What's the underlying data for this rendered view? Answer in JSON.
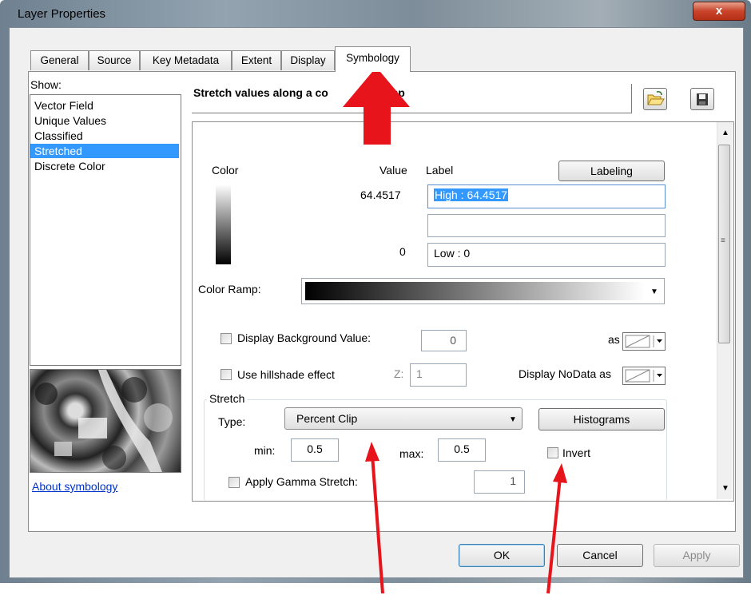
{
  "window": {
    "title": "Layer Properties",
    "close_glyph": "x"
  },
  "tabs": [
    {
      "label": "General"
    },
    {
      "label": "Source"
    },
    {
      "label": "Key Metadata"
    },
    {
      "label": "Extent"
    },
    {
      "label": "Display"
    },
    {
      "label": "Symbology",
      "active": true
    }
  ],
  "show": {
    "label": "Show:",
    "items": [
      "Vector Field",
      "Unique Values",
      "Classified",
      "Stretched",
      "Discrete Color"
    ],
    "selected": "Stretched",
    "about_link": "About symbology"
  },
  "header": {
    "title": "Stretch values along a co",
    "title_tail": "mp"
  },
  "ramp_table": {
    "color_header": "Color",
    "value_header": "Value",
    "label_header": "Label",
    "labeling_button": "Labeling",
    "high_value": "64.4517",
    "high_label": "High : 64.4517",
    "mid_label": "",
    "low_value": "0",
    "low_label": "Low : 0"
  },
  "color_ramp": {
    "label": "Color Ramp:"
  },
  "background": {
    "label": "Display Background Value:",
    "value": "0",
    "as_label": "as",
    "checked": false
  },
  "hillshade": {
    "label": "Use hillshade effect",
    "z_label": "Z:",
    "z_value": "1",
    "nodata_label": "Display NoData as",
    "checked": false
  },
  "stretch": {
    "group_label": "Stretch",
    "type_label": "Type:",
    "type_value": "Percent Clip",
    "histograms_button": "Histograms",
    "min_label": "min:",
    "min_value": "0.5",
    "max_label": "max:",
    "max_value": "0.5",
    "invert_label": "Invert",
    "invert_checked": false,
    "gamma_label": "Apply Gamma Stretch:",
    "gamma_value": "1",
    "gamma_checked": false
  },
  "buttons": {
    "ok": "OK",
    "cancel": "Cancel",
    "apply": "Apply"
  },
  "colors": {
    "selection": "#3399ff",
    "annotation_arrow": "#e8141c"
  }
}
